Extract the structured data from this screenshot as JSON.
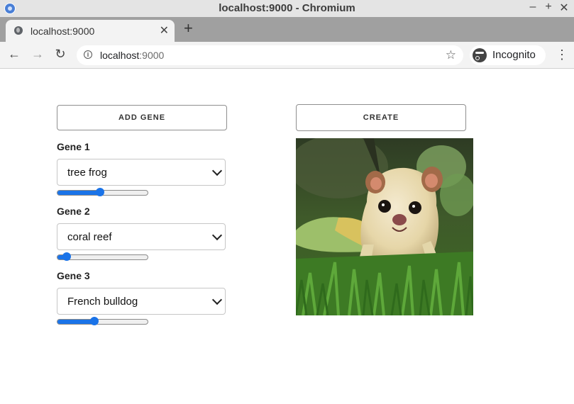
{
  "window": {
    "title": "localhost:9000 - Chromium"
  },
  "tab": {
    "title": "localhost:9000"
  },
  "address_bar": {
    "host": "localhost",
    "port": ":9000"
  },
  "profile": {
    "label": "Incognito"
  },
  "controls": {
    "add_gene_label": "ADD GENE",
    "create_label": "CREATE"
  },
  "genes": [
    {
      "label": "Gene 1",
      "value": "tree frog",
      "level": 0.47
    },
    {
      "label": "Gene 2",
      "value": "coral reef",
      "level": 0.11
    },
    {
      "label": "Gene 3",
      "value": "French bulldog",
      "level": 0.41
    }
  ],
  "colors": {
    "accent": "#1a73e8"
  }
}
